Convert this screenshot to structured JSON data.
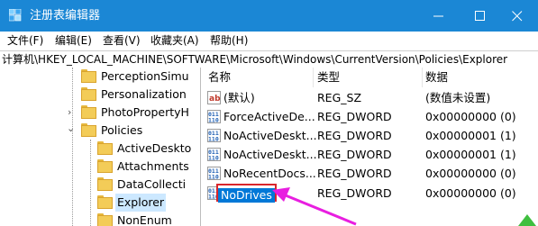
{
  "window": {
    "title": "注册表编辑器",
    "minimize_icon": "minimize-icon",
    "maximize_icon": "maximize-icon",
    "close_icon": "close-icon",
    "titlebar_color": "#1b87d5"
  },
  "menu": {
    "items": [
      "文件(F)",
      "编辑(E)",
      "查看(V)",
      "收藏夹(A)",
      "帮助(H)"
    ]
  },
  "address": {
    "path": "计算机\\HKEY_LOCAL_MACHINE\\SOFTWARE\\Microsoft\\Windows\\CurrentVersion\\Policies\\Explorer"
  },
  "tree": {
    "items": [
      {
        "label": "PerceptionSimu"
      },
      {
        "label": "Personalization"
      },
      {
        "label": "PhotoPropertyH",
        "expander": "›"
      },
      {
        "label": "Policies",
        "expander": "⌄"
      },
      {
        "label": "ActiveDeskto"
      },
      {
        "label": "Attachments"
      },
      {
        "label": "DataCollecti"
      },
      {
        "label": "Explorer",
        "selected": true
      },
      {
        "label": "NonEnum"
      }
    ]
  },
  "list": {
    "headers": {
      "name": "名称",
      "type": "类型",
      "data": "数据"
    },
    "rows": [
      {
        "name": "(默认)",
        "type": "REG_SZ",
        "data": "(数值未设置)",
        "icon": "string-value-icon"
      },
      {
        "name": "ForceActiveDe...",
        "type": "REG_DWORD",
        "data": "0x00000000 (0)",
        "icon": "dword-value-icon"
      },
      {
        "name": "NoActiveDeskt...",
        "type": "REG_DWORD",
        "data": "0x00000001 (1)",
        "icon": "dword-value-icon"
      },
      {
        "name": "NoActiveDeskt...",
        "type": "REG_DWORD",
        "data": "0x00000001 (1)",
        "icon": "dword-value-icon"
      },
      {
        "name": "NoRecentDocs...",
        "type": "REG_DWORD",
        "data": "0x00000000 (0)",
        "icon": "dword-value-icon"
      },
      {
        "name": "NoDrives",
        "type": "REG_DWORD",
        "data": "0x00000000 (0)",
        "icon": "dword-value-icon",
        "selected": true
      }
    ]
  },
  "annotation": {
    "highlight_color": "#d9262c",
    "arrow_color": "#e81ee0"
  }
}
